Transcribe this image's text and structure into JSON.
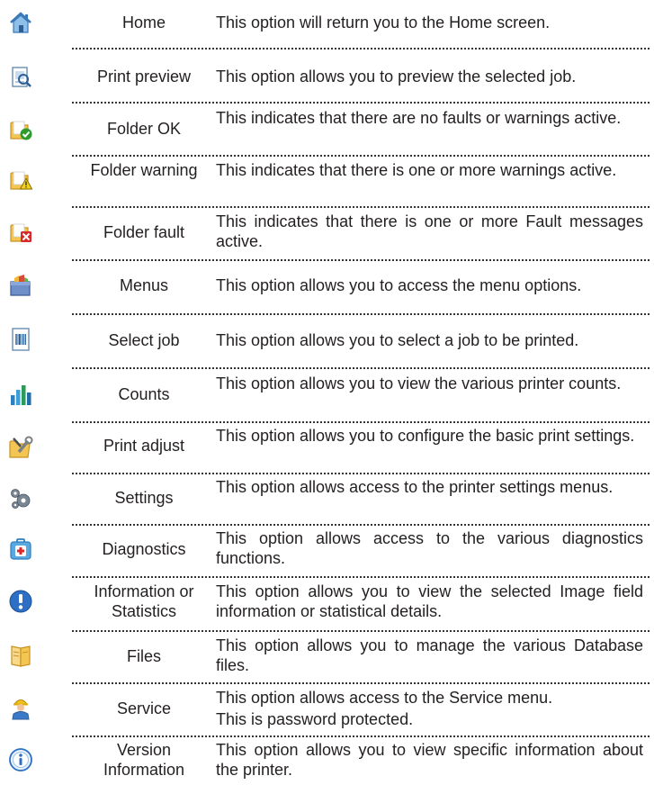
{
  "rows": [
    {
      "icon": "home-icon",
      "name": "Home",
      "desc": "This option will return you to the Home screen."
    },
    {
      "icon": "print-preview-icon",
      "name": "Print preview",
      "desc": "This option allows you to preview the selected job."
    },
    {
      "icon": "folder-ok-icon",
      "name": "Folder OK",
      "desc": "This indicates that there are no faults or warnings active."
    },
    {
      "icon": "folder-warning-icon",
      "name": "Folder warning",
      "desc": "This indicates that there is one or more warnings active."
    },
    {
      "icon": "folder-fault-icon",
      "name": "Folder fault",
      "desc": "This indicates that there is one or more Fault messages active."
    },
    {
      "icon": "menus-icon",
      "name": "Menus",
      "desc": "This option allows you to access the menu options."
    },
    {
      "icon": "select-job-icon",
      "name": "Select job",
      "desc": "This option allows you to select a job to be printed."
    },
    {
      "icon": "counts-icon",
      "name": "Counts",
      "desc": "This option allows you to view the various printer counts."
    },
    {
      "icon": "print-adjust-icon",
      "name": "Print adjust",
      "desc": "This option allows you to configure the basic print settings."
    },
    {
      "icon": "settings-icon",
      "name": "Settings",
      "desc": "This option allows access to the printer settings menus."
    },
    {
      "icon": "diagnostics-icon",
      "name": "Diagnostics",
      "desc": "This option allows access to the various diagnostics functions."
    },
    {
      "icon": "information-icon",
      "name": "Information or Statistics",
      "desc": "This option allows you to view the selected Image field information or statistical details."
    },
    {
      "icon": "files-icon",
      "name": "Files",
      "desc": "This option allows you to manage the various Database files."
    },
    {
      "icon": "service-icon",
      "name": "Service",
      "desc": "This option allows access to the Service menu.",
      "desc2": "This is password protected."
    },
    {
      "icon": "version-info-icon",
      "name": "Version Information",
      "desc": "This option allows you to view specific information about the printer."
    }
  ]
}
